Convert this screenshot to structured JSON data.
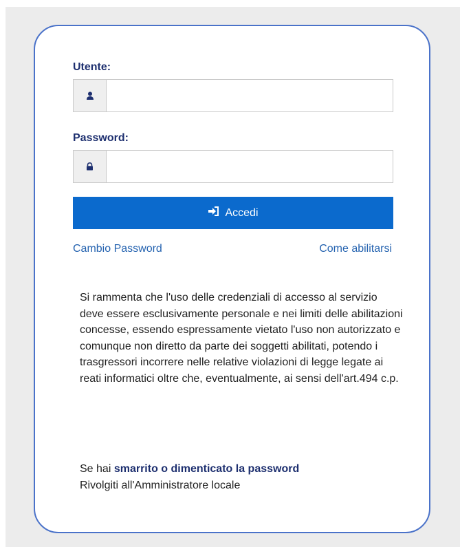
{
  "login": {
    "username_label": "Utente:",
    "username_value": "",
    "password_label": "Password:",
    "password_value": "",
    "submit_label": "Accedi",
    "change_password_link": "Cambio Password",
    "how_to_enable_link": "Come abilitarsi"
  },
  "icons": {
    "username": "user-icon",
    "password": "lock-icon",
    "submit": "sign-in-icon"
  },
  "notice": {
    "text": "Si rammenta che l'uso delle credenziali di accesso al servizio deve essere esclusivamente personale e nei limiti delle abilitazioni concesse, essendo espressamente vietato l'uso non autorizzato e comunque non diretto da parte dei soggetti abilitati, potendo i trasgressori incorrere nelle relative violazioni di legge legate ai reati informatici oltre che, eventualmente, ai sensi dell'art.494 c.p."
  },
  "recovery": {
    "prefix": "Se hai",
    "emphasis": "smarrito o dimenticato la password",
    "instruction": "Rivolgiti all'Amministratore locale"
  },
  "colors": {
    "accent": "#0b6acd",
    "border": "#4a72c9",
    "label": "#1d2f6f",
    "link": "#2563b0",
    "backdrop": "#ececec"
  }
}
